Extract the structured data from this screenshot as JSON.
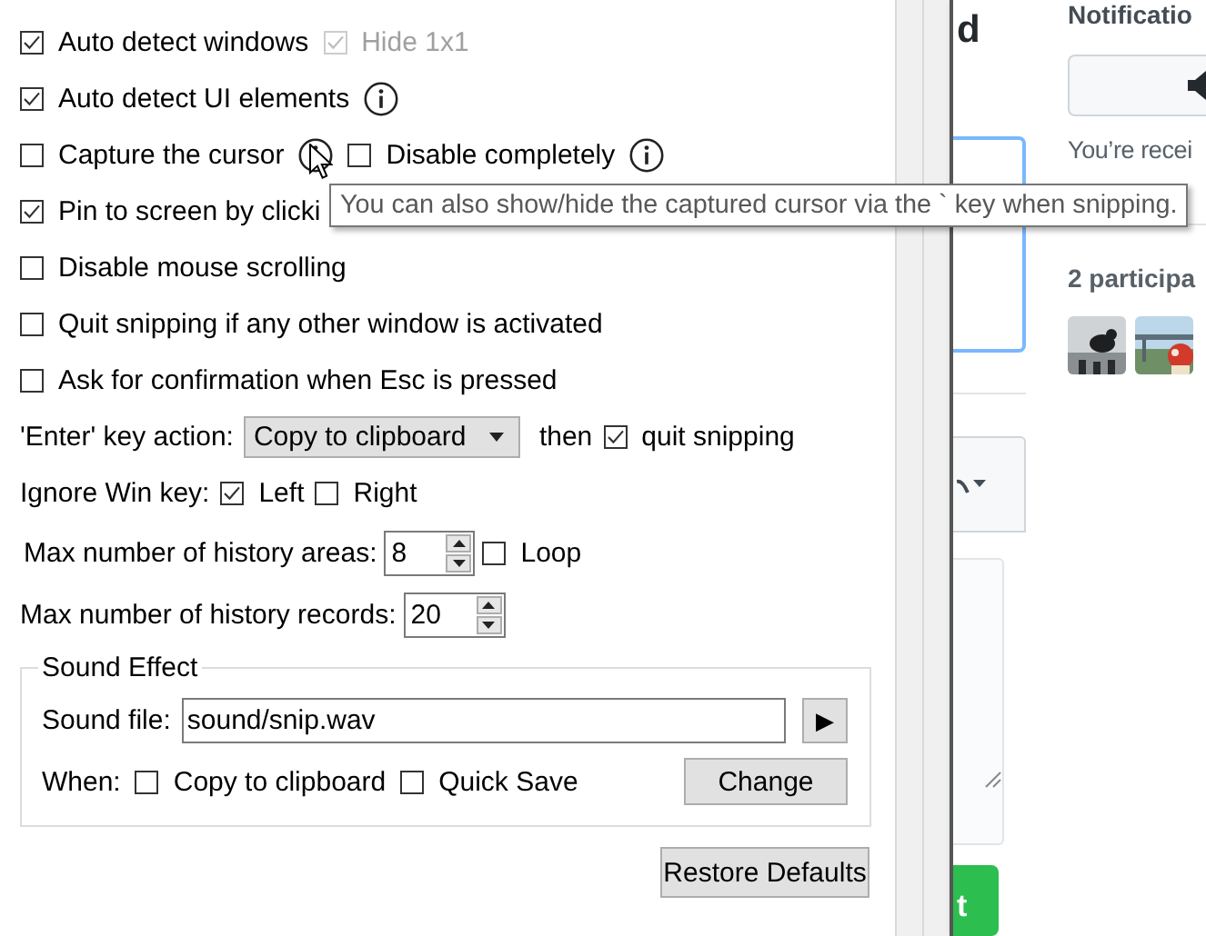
{
  "rows": [
    {
      "items": [
        {
          "kind": "checkbox",
          "label": "Auto detect windows",
          "checked": true,
          "disabled": false
        },
        {
          "kind": "checkbox",
          "label": "Hide 1x1",
          "checked": true,
          "disabled": true
        }
      ]
    },
    {
      "items": [
        {
          "kind": "checkbox",
          "label": "Auto detect UI elements",
          "checked": true,
          "disabled": false
        },
        {
          "kind": "info"
        }
      ]
    },
    {
      "items": [
        {
          "kind": "checkbox",
          "label": "Capture the cursor",
          "checked": false,
          "disabled": false
        },
        {
          "kind": "info"
        },
        {
          "kind": "checkbox",
          "label": "Disable completely",
          "checked": false,
          "disabled": false
        },
        {
          "kind": "info"
        }
      ]
    },
    {
      "items": [
        {
          "kind": "checkbox",
          "label": "Pin to screen by clicki",
          "checked": true,
          "disabled": false
        }
      ]
    },
    {
      "items": [
        {
          "kind": "checkbox",
          "label": "Disable mouse scrolling",
          "checked": false,
          "disabled": false
        }
      ]
    },
    {
      "items": [
        {
          "kind": "checkbox",
          "label": "Quit snipping if any other window is activated",
          "checked": false,
          "disabled": false
        }
      ]
    },
    {
      "items": [
        {
          "kind": "checkbox",
          "label": "Ask for confirmation when Esc is pressed",
          "checked": false,
          "disabled": false
        }
      ]
    },
    {
      "items": [
        {
          "kind": "label",
          "label": "'Enter' key action:"
        },
        {
          "kind": "dropdown",
          "value": "Copy to clipboard"
        },
        {
          "kind": "label",
          "label": "then"
        },
        {
          "kind": "checkbox",
          "label": "quit snipping",
          "checked": true,
          "disabled": false
        }
      ]
    },
    {
      "items": [
        {
          "kind": "label",
          "label": "Ignore Win key:"
        },
        {
          "kind": "checkbox",
          "label": "Left",
          "checked": true,
          "disabled": false
        },
        {
          "kind": "checkbox",
          "label": "Right",
          "checked": false,
          "disabled": false
        }
      ]
    },
    {
      "items": [
        {
          "kind": "label",
          "label": "Max number of history areas:"
        },
        {
          "kind": "spin",
          "value": "8"
        },
        {
          "kind": "checkbox",
          "label": "Loop",
          "checked": false,
          "disabled": false
        }
      ]
    },
    {
      "items": [
        {
          "kind": "label",
          "label": "Max number of history records:"
        },
        {
          "kind": "spin",
          "value": "20"
        }
      ]
    }
  ],
  "sound_effect": {
    "title": "Sound Effect",
    "file_label": "Sound file:",
    "file_value": "sound/snip.wav",
    "play_button": "▶",
    "when_label": "When:",
    "when_options": [
      {
        "label": "Copy to clipboard",
        "checked": false
      },
      {
        "label": "Quick Save",
        "checked": false
      }
    ],
    "change_button": "Change"
  },
  "restore_button": "Restore Defaults",
  "tooltip": "You can also show/hide the captured cursor via the ` key when snipping.",
  "background_page": {
    "heading": "d",
    "sidebar_title": "Notificatio",
    "notice": "You’re recei",
    "participants": "2 participa",
    "submit_button": "t"
  }
}
